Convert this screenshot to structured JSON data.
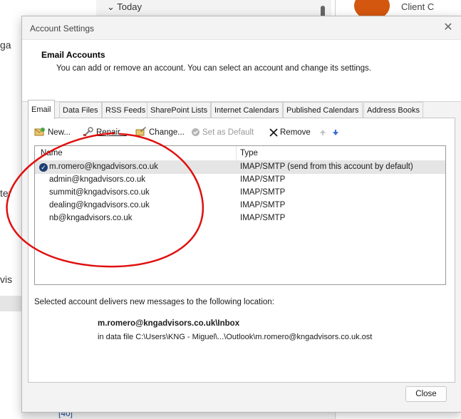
{
  "background": {
    "left_fragments": [
      "ga",
      "ter",
      "vis"
    ],
    "top_label": "Today",
    "contact_name": "Client C",
    "bottom_count": "[40]",
    "avatar_color": "#d4570f"
  },
  "dialog": {
    "title": "Account Settings",
    "close_glyph": "✕",
    "header": {
      "heading": "Email Accounts",
      "description": "You can add or remove an account. You can select an account and change its settings."
    },
    "tabs": [
      {
        "label": "Email"
      },
      {
        "label": "Data Files"
      },
      {
        "label": "RSS Feeds"
      },
      {
        "label": "SharePoint Lists"
      },
      {
        "label": "Internet Calendars"
      },
      {
        "label": "Published Calendars"
      },
      {
        "label": "Address Books"
      }
    ],
    "toolbar": {
      "new_label": "New...",
      "repair_label": "Repair...",
      "change_label": "Change...",
      "set_default_label": "Set as Default",
      "remove_label": "Remove",
      "move_up_icon": "arrow-up-icon",
      "move_down_icon": "arrow-down-icon"
    },
    "list": {
      "columns": {
        "name": "Name",
        "type": "Type"
      },
      "accounts": [
        {
          "name": "m.romero@kngadvisors.co.uk",
          "type": "IMAP/SMTP (send from this account by default)"
        },
        {
          "name": "admin@kngadvisors.co.uk",
          "type": "IMAP/SMTP"
        },
        {
          "name": "summit@kngadvisors.co.uk",
          "type": "IMAP/SMTP"
        },
        {
          "name": "dealing@kngadvisors.co.uk",
          "type": "IMAP/SMTP"
        },
        {
          "name": "nb@kngadvisors.co.uk",
          "type": "IMAP/SMTP"
        }
      ]
    },
    "delivery": {
      "label": "Selected account delivers new messages to the following location:",
      "folder": "m.romero@kngadvisors.co.uk\\Inbox",
      "file": "in data file C:\\Users\\KNG - Miguel\\...\\Outlook\\m.romero@kngadvisors.co.uk.ost"
    },
    "close_button_label": "Close"
  },
  "colors": {
    "annotation": "#e01010",
    "default_check": "#1d3f74",
    "move_down_arrow": "#3b6fd6"
  }
}
